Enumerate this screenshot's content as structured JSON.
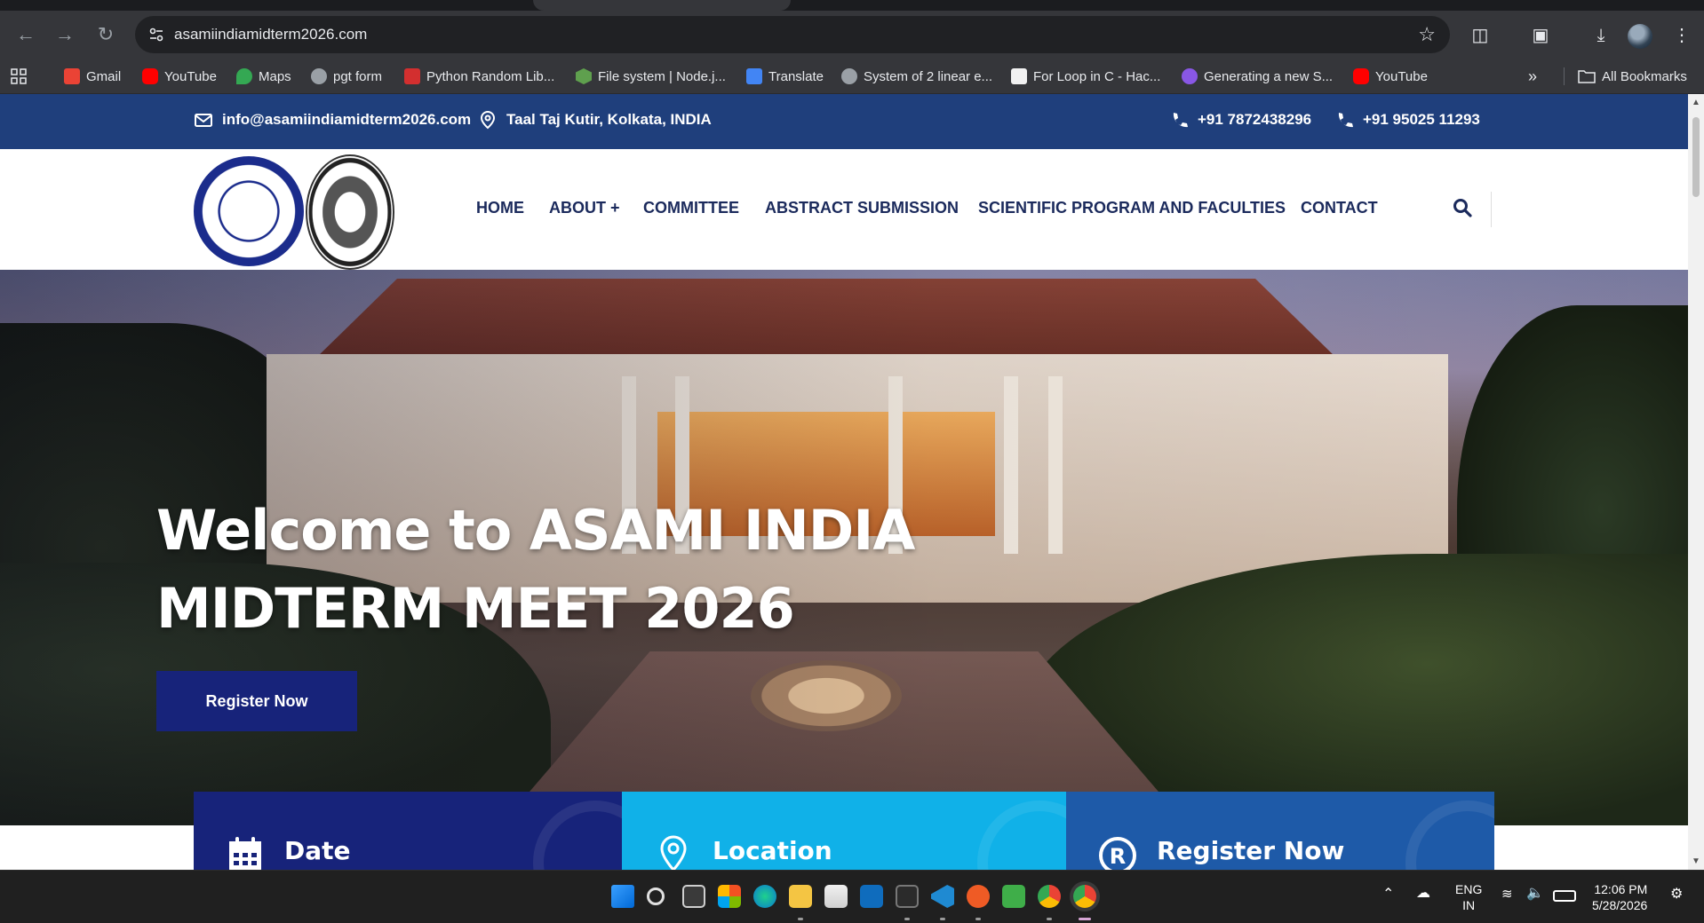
{
  "browser": {
    "url": "asamiindiamidterm2026.com",
    "bookmarks": [
      {
        "label": "Gmail",
        "icon": "gmail-icon",
        "color": "#ea4335"
      },
      {
        "label": "YouTube",
        "icon": "youtube-icon",
        "color": "#ff0000"
      },
      {
        "label": "Maps",
        "icon": "maps-icon",
        "color": "#34a853"
      },
      {
        "label": "pgt form",
        "icon": "globe-icon",
        "color": "#9aa0a6"
      },
      {
        "label": "Python Random Lib...",
        "icon": "scaler-icon",
        "color": "#d32f2f"
      },
      {
        "label": "File system | Node.j...",
        "icon": "nodejs-icon",
        "color": "#5fa04e"
      },
      {
        "label": "Translate",
        "icon": "translate-icon",
        "color": "#4285f4"
      },
      {
        "label": "System of 2 linear e...",
        "icon": "globe-icon",
        "color": "#9aa0a6"
      },
      {
        "label": "For Loop in C - Hac...",
        "icon": "page-icon",
        "color": "#f1f1f1"
      },
      {
        "label": "Generating a new S...",
        "icon": "github-icon",
        "color": "#8957e5"
      },
      {
        "label": "YouTube",
        "icon": "youtube-icon",
        "color": "#ff0000"
      }
    ],
    "all_bookmarks": "All Bookmarks"
  },
  "site": {
    "topbar": {
      "email": "info@asamiindiamidterm2026.com",
      "address": "Taal Taj Kutir, Kolkata, INDIA",
      "phone1": "+91 7872438296",
      "phone2": "+91 95025 11293"
    },
    "nav": [
      "HOME",
      "ABOUT +",
      "COMMITTEE",
      "ABSTRACT SUBMISSION",
      "SCIENTIFIC PROGRAM AND FACULTIES",
      "CONTACT"
    ],
    "hero": {
      "title_line1": "Welcome to ASAMI INDIA",
      "title_line2": "MIDTERM MEET 2026",
      "cta": "Register Now"
    },
    "cards": [
      {
        "title": "Date",
        "icon": "calendar-icon",
        "color": "#17237a"
      },
      {
        "title": "Location",
        "icon": "location-pin-icon",
        "color": "#10b1e8"
      },
      {
        "title": "Register Now",
        "icon": "registered-icon",
        "color": "#1e5aa8"
      }
    ]
  },
  "taskbar": {
    "language": "ENG",
    "region": "IN",
    "time": "12:06 PM",
    "date": "5/28/2026"
  }
}
